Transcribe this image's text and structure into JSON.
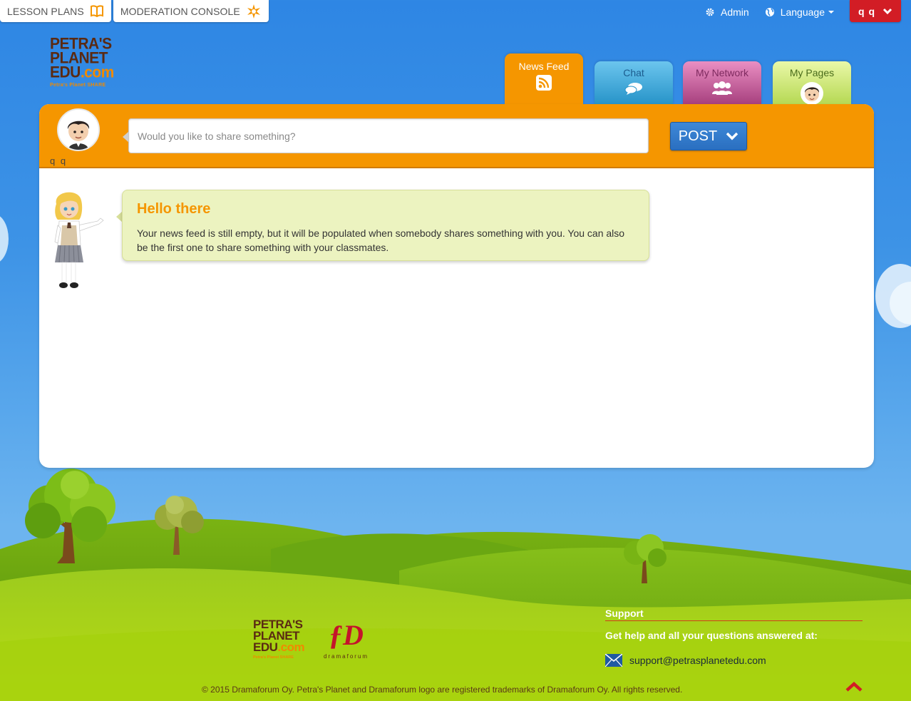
{
  "top_left": {
    "lesson_plans": "LESSON PLANS",
    "moderation_console": "MODERATION CONSOLE"
  },
  "top_right": {
    "admin": "Admin",
    "language": "Language",
    "user_initials": "q q"
  },
  "logo": {
    "line1": "PETRA'S",
    "line2": "PLANET",
    "line3_main": "EDU",
    "line3_suffix": ".com",
    "tagline": "Petra's Planet SHARE"
  },
  "tabs": [
    {
      "label": "News Feed",
      "icon": "rss-icon",
      "active": true
    },
    {
      "label": "Chat",
      "icon": "chat-bubbles-icon",
      "active": false
    },
    {
      "label": "My Network",
      "icon": "users-icon",
      "active": false
    },
    {
      "label": "My Pages",
      "icon": "avatar-icon",
      "active": false
    }
  ],
  "composer": {
    "user_name": "q q",
    "placeholder": "Would you like to share something?",
    "post_label": "POST"
  },
  "empty_feed": {
    "title": "Hello there",
    "message": "Your news feed is still empty, but it will be populated when somebody shares something with you. You can also be the first one to share something with your classmates."
  },
  "footer": {
    "dramaforum_logo": "ƒD",
    "dramaforum_name": "dramaforum",
    "support_heading": "Support",
    "support_text": "Get help and all your questions answered at:",
    "support_email": "support@petrasplanetedu.com",
    "copyright": "© 2015 Dramaforum Oy. Petra's Planet and Dramaforum logo are registered trademarks of Dramaforum Oy. All rights reserved."
  },
  "colors": {
    "sky": "#2e86e4",
    "accent_orange": "#f59600",
    "post_blue": "#2a6fc0",
    "user_red": "#d21d25"
  }
}
